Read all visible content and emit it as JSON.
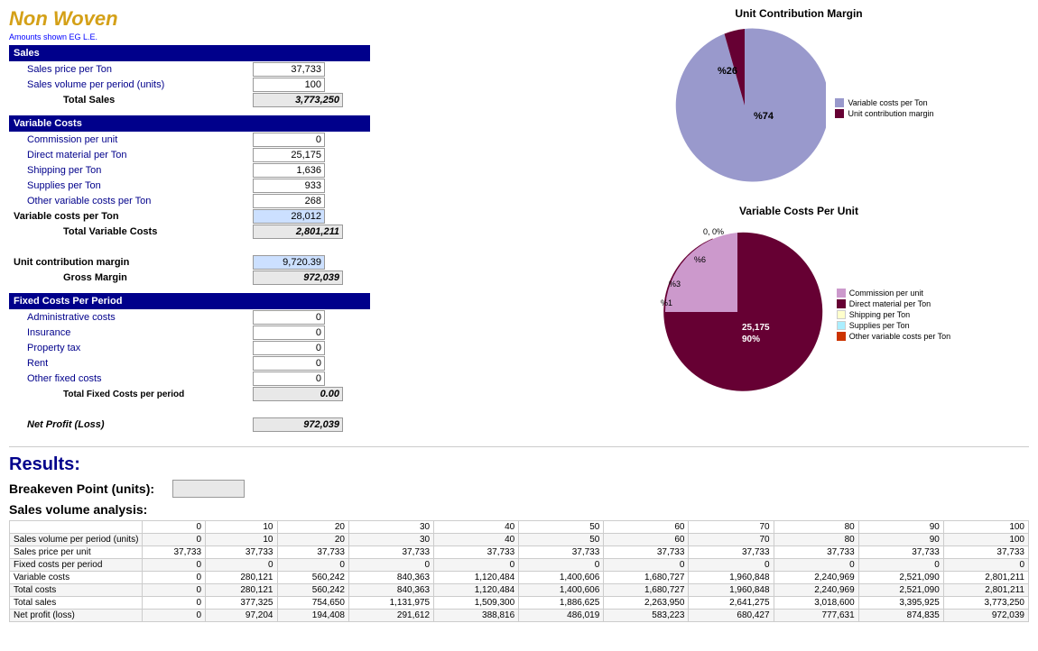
{
  "title": "Non Woven",
  "amounts_label": "Amounts shown EG L.E.",
  "sales_section": {
    "header": "Sales",
    "rows": [
      {
        "label": "Sales price per Ton",
        "value": "37,733"
      },
      {
        "label": "Sales volume per period (units)",
        "value": "100"
      }
    ],
    "total_label": "Total Sales",
    "total_value": "3,773,250"
  },
  "variable_costs_section": {
    "header": "Variable Costs",
    "rows": [
      {
        "label": "Commission per unit",
        "value": "0"
      },
      {
        "label": "Direct material per Ton",
        "value": "25,175"
      },
      {
        "label": "Shipping per Ton",
        "value": "1,636"
      },
      {
        "label": "Supplies per Ton",
        "value": "933"
      },
      {
        "label": "Other variable costs per Ton",
        "value": "268"
      }
    ],
    "subtotal_label": "Variable costs per Ton",
    "subtotal_value": "28,012",
    "total_label": "Total Variable Costs",
    "total_value": "2,801,211",
    "ucm_label": "Unit contribution margin",
    "ucm_value": "9,720.39",
    "gm_label": "Gross Margin",
    "gm_value": "972,039"
  },
  "fixed_costs_section": {
    "header": "Fixed Costs Per Period",
    "rows": [
      {
        "label": "Administrative costs",
        "value": "0"
      },
      {
        "label": "Insurance",
        "value": "0"
      },
      {
        "label": "Property tax",
        "value": "0"
      },
      {
        "label": "Rent",
        "value": "0"
      },
      {
        "label": "Other fixed costs",
        "value": "0"
      }
    ],
    "total_label": "Total Fixed Costs per period",
    "total_value": "0.00",
    "net_profit_label": "Net Profit (Loss)",
    "net_profit_value": "972,039"
  },
  "ucm_chart": {
    "title": "Unit Contribution Margin",
    "legend": [
      {
        "label": "Variable costs per Ton",
        "color": "#9999cc"
      },
      {
        "label": "Unit contribution margin",
        "color": "#660033"
      }
    ],
    "slices": [
      {
        "pct": 74,
        "label": "%74",
        "color": "#9999cc"
      },
      {
        "pct": 26,
        "label": "%26",
        "color": "#660033"
      }
    ]
  },
  "var_cost_chart": {
    "title": "Variable Costs Per Unit",
    "legend": [
      {
        "label": "Commission per unit",
        "color": "#cc99cc"
      },
      {
        "label": "Direct material per Ton",
        "color": "#660033"
      },
      {
        "label": "Shipping per Ton",
        "color": "#ffffcc"
      },
      {
        "label": "Supplies per Ton",
        "color": "#ccffff"
      },
      {
        "label": "Other variable costs per Ton",
        "color": "#cc3300"
      }
    ],
    "slices": [
      {
        "pct": 0,
        "label": "0, 0%",
        "color": "#cc99cc"
      },
      {
        "pct": 90,
        "label": "25,175\n90%",
        "color": "#660033"
      },
      {
        "pct": 6,
        "label": "%6",
        "color": "#cc3300"
      },
      {
        "pct": 3,
        "label": "%3",
        "color": "#ffffcc"
      },
      {
        "pct": 1,
        "label": "%1",
        "color": "#ccffff"
      }
    ]
  },
  "results": {
    "title": "Results:",
    "breakeven_label": "Breakeven Point (units):",
    "breakeven_value": "",
    "sales_analysis_title": "Sales volume analysis:",
    "table_headers": [
      "",
      "0",
      "10",
      "20",
      "30",
      "40",
      "50",
      "60",
      "70",
      "80",
      "90",
      "100"
    ],
    "table_rows": [
      {
        "label": "Sales volume per period (units)",
        "values": [
          "0",
          "10",
          "20",
          "30",
          "40",
          "50",
          "60",
          "70",
          "80",
          "90",
          "100"
        ]
      },
      {
        "label": "Sales price per unit",
        "values": [
          "37,733",
          "37,733",
          "37,733",
          "37,733",
          "37,733",
          "37,733",
          "37,733",
          "37,733",
          "37,733",
          "37,733",
          "37,733"
        ]
      },
      {
        "label": "Fixed costs per period",
        "values": [
          "0",
          "0",
          "0",
          "0",
          "0",
          "0",
          "0",
          "0",
          "0",
          "0",
          "0"
        ]
      },
      {
        "label": "Variable costs",
        "values": [
          "0",
          "280,121",
          "560,242",
          "840,363",
          "1,120,484",
          "1,400,606",
          "1,680,727",
          "1,960,848",
          "2,240,969",
          "2,521,090",
          "2,801,211"
        ]
      },
      {
        "label": "Total costs",
        "values": [
          "0",
          "280,121",
          "560,242",
          "840,363",
          "1,120,484",
          "1,400,606",
          "1,680,727",
          "1,960,848",
          "2,240,969",
          "2,521,090",
          "2,801,211"
        ]
      },
      {
        "label": "Total sales",
        "values": [
          "0",
          "377,325",
          "754,650",
          "1,131,975",
          "1,509,300",
          "1,886,625",
          "2,263,950",
          "2,641,275",
          "3,018,600",
          "3,395,925",
          "3,773,250"
        ]
      },
      {
        "label": "Net profit (loss)",
        "values": [
          "0",
          "97,204",
          "194,408",
          "291,612",
          "388,816",
          "486,019",
          "583,223",
          "680,427",
          "777,631",
          "874,835",
          "972,039"
        ]
      }
    ]
  }
}
